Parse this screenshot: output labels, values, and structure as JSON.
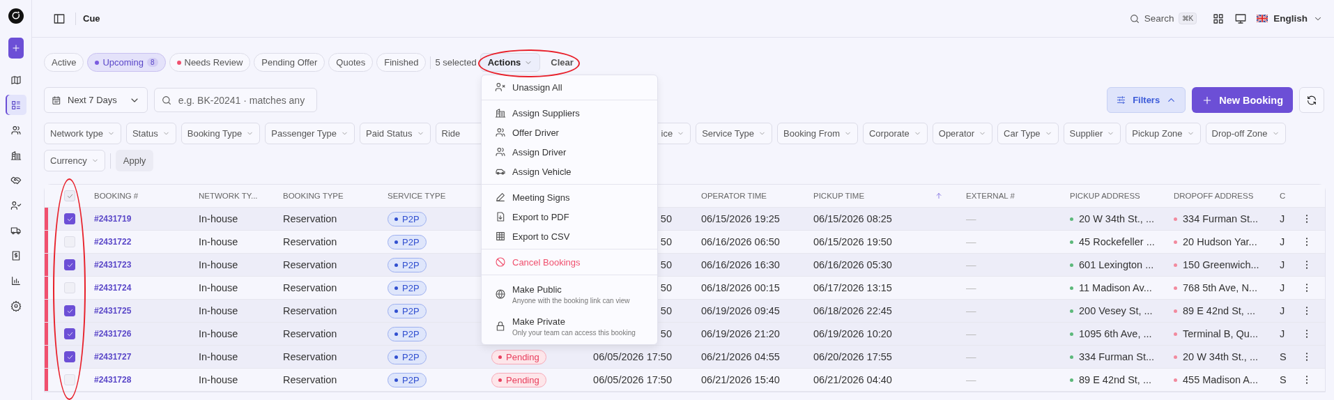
{
  "header": {
    "title": "Cue",
    "search_label": "Search",
    "search_shortcut": "⌘K",
    "language": "English"
  },
  "sidebar": {
    "items": [
      {
        "kind": "map",
        "selected": false
      },
      {
        "kind": "list",
        "selected": true
      },
      {
        "kind": "users",
        "selected": false
      },
      {
        "kind": "building",
        "selected": false
      },
      {
        "kind": "handshake",
        "selected": false
      },
      {
        "kind": "user-check",
        "selected": false
      },
      {
        "kind": "truck",
        "selected": false
      },
      {
        "kind": "invoice",
        "selected": false
      },
      {
        "kind": "chart",
        "selected": false
      },
      {
        "kind": "gear",
        "selected": false
      }
    ]
  },
  "status_tabs": [
    {
      "label": "Active",
      "selected": false
    },
    {
      "label": "Upcoming",
      "selected": true,
      "color": "#7b5ce0",
      "count": "8"
    },
    {
      "label": "Needs Review",
      "selected": false,
      "color": "#f0506e"
    },
    {
      "label": "Pending Offer",
      "selected": false
    },
    {
      "label": "Quotes",
      "selected": false
    },
    {
      "label": "Finished",
      "selected": false
    }
  ],
  "selection": {
    "count_text": "5 selected",
    "actions_label": "Actions",
    "clear_label": "Clear"
  },
  "date_range": "Next 7 Days",
  "search": {
    "placeholder": "e.g. BK-20241 · matches any"
  },
  "filters_button": {
    "label": "Filters",
    "expanded": true
  },
  "new_booking_label": "New Booking",
  "filter_rows": [
    [
      {
        "label": "Network type",
        "kind": "full"
      },
      {
        "label": "Status",
        "kind": "full"
      },
      {
        "label": "Booking Type",
        "kind": "full"
      },
      {
        "label": "Passenger Type",
        "kind": "full"
      },
      {
        "label": "Paid Status",
        "kind": "full"
      },
      {
        "label": "Ride",
        "kind": "cut-end"
      },
      {
        "label": "ice",
        "kind": "cut-start"
      },
      {
        "label": "Service Type",
        "kind": "full"
      },
      {
        "label": "Booking From",
        "kind": "full"
      },
      {
        "label": "Corporate",
        "kind": "full"
      },
      {
        "label": "Operator",
        "kind": "full"
      },
      {
        "label": "Car Type",
        "kind": "full"
      },
      {
        "label": "Supplier",
        "kind": "full"
      },
      {
        "label": "Pickup Zone",
        "kind": "full"
      },
      {
        "label": "Drop-off Zone",
        "kind": "full"
      }
    ],
    [
      {
        "label": "Currency",
        "kind": "full"
      }
    ]
  ],
  "apply_label": "Apply",
  "table": {
    "select_all": {
      "checked": true
    },
    "columns": [
      {
        "label": "BOOKING #",
        "sorted": false
      },
      {
        "label": "NETWORK TY...",
        "sorted": false
      },
      {
        "label": "BOOKING TYPE",
        "sorted": false
      },
      {
        "label": "SERVICE TYPE",
        "sorted": false
      },
      {
        "label": "OPERATOR TIME",
        "sorted": false
      },
      {
        "label": "PICKUP TIME",
        "sorted": true
      },
      {
        "label": "EXTERNAL #",
        "sorted": false
      },
      {
        "label": "PICKUP ADDRESS",
        "sorted": false
      },
      {
        "label": "DROPOFF ADDRESS",
        "sorted": false
      },
      {
        "label": "C",
        "sorted": false
      }
    ],
    "rows": [
      {
        "flagged": true,
        "selected": true,
        "booking": "#2431719",
        "network": "In-house",
        "booking_type": "Reservation",
        "service": "P2P",
        "time": "50",
        "operator_time": "06/15/2026 19:25",
        "pickup_time": "06/15/2026 08:25",
        "external": "—",
        "pickup_address": "20 W 34th St., ...",
        "dropoff_address": "334 Furman St...",
        "column_12": "J"
      },
      {
        "flagged": true,
        "selected": false,
        "booking": "#2431722",
        "network": "In-house",
        "booking_type": "Reservation",
        "service": "P2P",
        "time": "50",
        "operator_time": "06/16/2026 06:50",
        "pickup_time": "06/15/2026 19:50",
        "external": "—",
        "pickup_address": "45 Rockefeller ...",
        "dropoff_address": "20 Hudson Yar...",
        "column_12": "J"
      },
      {
        "flagged": true,
        "selected": true,
        "booking": "#2431723",
        "network": "In-house",
        "booking_type": "Reservation",
        "service": "P2P",
        "time": "50",
        "operator_time": "06/16/2026 16:30",
        "pickup_time": "06/16/2026 05:30",
        "external": "—",
        "pickup_address": "601 Lexington ...",
        "dropoff_address": "150 Greenwich...",
        "column_12": "J"
      },
      {
        "flagged": true,
        "selected": false,
        "booking": "#2431724",
        "network": "In-house",
        "booking_type": "Reservation",
        "service": "P2P",
        "time": "50",
        "operator_time": "06/18/2026 00:15",
        "pickup_time": "06/17/2026 13:15",
        "external": "—",
        "pickup_address": "11 Madison Av...",
        "dropoff_address": "768 5th Ave, N...",
        "column_12": "J"
      },
      {
        "flagged": true,
        "selected": true,
        "booking": "#2431725",
        "network": "In-house",
        "booking_type": "Reservation",
        "service": "P2P",
        "time": "50",
        "operator_time": "06/19/2026 09:45",
        "pickup_time": "06/18/2026 22:45",
        "external": "—",
        "pickup_address": "200 Vesey St, ...",
        "dropoff_address": "89 E 42nd St, ...",
        "column_12": "J"
      },
      {
        "flagged": true,
        "selected": true,
        "booking": "#2431726",
        "network": "In-house",
        "booking_type": "Reservation",
        "service": "P2P",
        "time": "50",
        "operator_time": "06/19/2026 21:20",
        "pickup_time": "06/19/2026 10:20",
        "external": "—",
        "pickup_address": "1095 6th Ave, ...",
        "dropoff_address": "Terminal B, Qu...",
        "column_12": "J"
      },
      {
        "flagged": true,
        "selected": true,
        "booking": "#2431727",
        "network": "In-house",
        "booking_type": "Reservation",
        "service": "P2P",
        "status": "Pending",
        "time": "06/05/2026 17:50",
        "operator_time": "06/21/2026 04:55",
        "pickup_time": "06/20/2026 17:55",
        "external": "—",
        "pickup_address": "334 Furman St...",
        "dropoff_address": "20 W 34th St., ...",
        "column_12": "S"
      },
      {
        "flagged": true,
        "selected": false,
        "booking": "#2431728",
        "network": "In-house",
        "booking_type": "Reservation",
        "service": "P2P",
        "status": "Pending",
        "time": "06/05/2026 17:50",
        "operator_time": "06/21/2026 15:40",
        "pickup_time": "06/21/2026 04:40",
        "external": "—",
        "pickup_address": "89 E 42nd St, ...",
        "dropoff_address": "455 Madison A...",
        "column_12": "S"
      }
    ]
  },
  "actions_menu": {
    "groups": [
      [
        {
          "label": "Unassign All",
          "kind": "unassign",
          "danger": false
        }
      ],
      [
        {
          "label": "Assign Suppliers",
          "kind": "suppliers",
          "danger": false
        },
        {
          "label": "Offer Driver",
          "kind": "people",
          "danger": false
        },
        {
          "label": "Assign Driver",
          "kind": "people",
          "danger": false
        },
        {
          "label": "Assign Vehicle",
          "kind": "vehicle",
          "danger": false
        }
      ],
      [
        {
          "label": "Meeting Signs",
          "kind": "signs",
          "danger": false
        },
        {
          "label": "Export to PDF",
          "kind": "pdf",
          "danger": false
        },
        {
          "label": "Export to CSV",
          "kind": "csv",
          "danger": false
        }
      ],
      [
        {
          "label": "Cancel Bookings",
          "kind": "cancel",
          "danger": true
        }
      ],
      [
        {
          "label": "Make Public",
          "kind": "public",
          "danger": false,
          "description": "Anyone with the booking link can view"
        },
        {
          "label": "Make Private",
          "kind": "private",
          "danger": false,
          "description": "Only your team can access this booking"
        }
      ]
    ]
  }
}
